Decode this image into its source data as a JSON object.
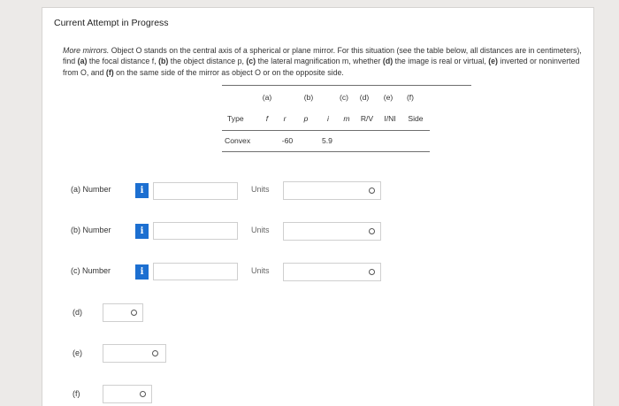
{
  "header": {
    "title": "Current Attempt in Progress"
  },
  "problem": {
    "intro_italic": "More mirrors.",
    "text_1": " Object O stands on the central axis of a spherical or plane mirror. For this situation (see the table below, all distances are in centimeters), find ",
    "lbl_a": "(a)",
    "text_2": " the focal distance f, ",
    "lbl_b": "(b)",
    "text_3": " the object distance p, ",
    "lbl_c": "(c)",
    "text_4": " the lateral magnification m, whether ",
    "lbl_d": "(d)",
    "text_5": " the image is real or virtual, ",
    "lbl_e": "(e)",
    "text_6": " inverted or noninverted from O, and ",
    "lbl_f": "(f)",
    "text_7": " on the same side of the mirror as object O or on the opposite side."
  },
  "table": {
    "part_labels": {
      "a": "(a)",
      "b": "(b)",
      "c": "(c)",
      "d": "(d)",
      "e": "(e)",
      "f": "(f)"
    },
    "headers": {
      "type": "Type",
      "f": "f",
      "r": "r",
      "p": "p",
      "i": "i",
      "m": "m",
      "rv": "R/V",
      "ini": "I/NI",
      "side": "Side"
    },
    "row": {
      "type": "Convex",
      "f": "",
      "r": "-60",
      "p": "",
      "i": "5.9",
      "m": "",
      "rv": "",
      "ini": "",
      "side": ""
    }
  },
  "answers": {
    "a": {
      "label": "(a)   Number",
      "info_icon": "i",
      "value": "",
      "units_placeholder": "Units"
    },
    "b": {
      "label": "(b)   Number",
      "info_icon": "i",
      "value": "",
      "units_placeholder": "Units"
    },
    "c": {
      "label": "(c)   Number",
      "info_icon": "i",
      "value": "",
      "units_placeholder": "Units"
    },
    "d": {
      "label": "(d)",
      "value": ""
    },
    "e": {
      "label": "(e)",
      "value": ""
    },
    "f": {
      "label": "(f)",
      "value": ""
    }
  },
  "colors": {
    "info_icon_bg": "#1c6fd1",
    "page_bg": "#eceae8",
    "panel_bg": "#ffffff"
  },
  "icons": {
    "info": "info-icon",
    "dropdown": "chevron-down-icon"
  }
}
